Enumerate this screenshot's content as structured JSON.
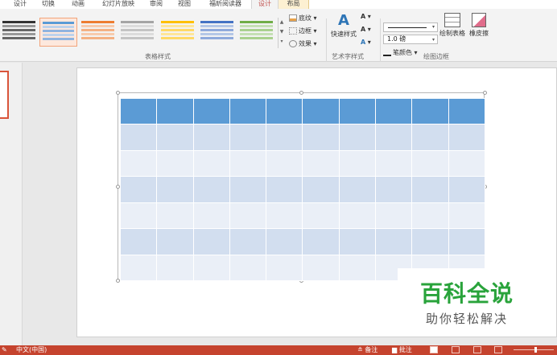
{
  "tabs": [
    {
      "label": "设计"
    },
    {
      "label": "切换"
    },
    {
      "label": "动画"
    },
    {
      "label": "幻灯片放映"
    },
    {
      "label": "审阅"
    },
    {
      "label": "视图"
    },
    {
      "label": "福昕阅读器"
    },
    {
      "label": "设计"
    },
    {
      "label": "布局"
    }
  ],
  "ribbon": {
    "table_styles_label": "表格样式",
    "shading_label": "底纹",
    "border_label": "边框",
    "effects_label": "效果",
    "quick_styles_label": "快速样式",
    "wordart_label": "艺术字样式",
    "pen_weight_label": "1.0 磅",
    "pen_color_label": "笔颜色",
    "draw_table_label": "绘制表格",
    "eraser_label": "橡皮擦",
    "draw_borders_label": "绘图边框"
  },
  "colors": {
    "accent": "#c5432e",
    "table_header": "#5b9bd5",
    "band_dark": "#d2deef",
    "band_light": "#eaeff7",
    "watermark_green": "#29a33b"
  },
  "watermark": {
    "title": "百科全说",
    "subtitle": "助你轻松解决"
  },
  "status": {
    "language": "中文(中国)",
    "notes_label": "备注",
    "comments_label": "批注"
  }
}
